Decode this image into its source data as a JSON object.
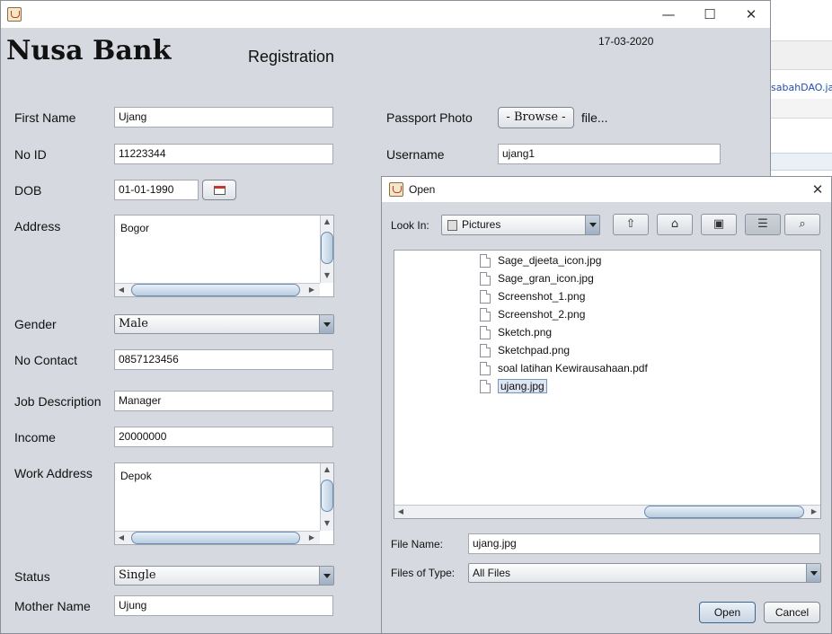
{
  "background": {
    "ide_tab_text": "sabahDAO.java"
  },
  "window": {
    "date": "17-03-2020",
    "bank_title": "Nusa Bank",
    "form_title": "Registration",
    "controls": {
      "minimize": "—",
      "maximize": "☐",
      "close": "✕"
    }
  },
  "form": {
    "first_name": {
      "label": "First Name",
      "value": "Ujang"
    },
    "no_id": {
      "label": "No ID",
      "value": "11223344"
    },
    "dob": {
      "label": "DOB",
      "value": "01-01-1990"
    },
    "address": {
      "label": "Address",
      "value": "Bogor"
    },
    "gender": {
      "label": "Gender",
      "value": "Male"
    },
    "no_contact": {
      "label": "No Contact",
      "value": "0857123456"
    },
    "job_description": {
      "label": "Job Description",
      "value": "Manager"
    },
    "income": {
      "label": "Income",
      "value": "20000000"
    },
    "work_address": {
      "label": "Work Address",
      "value": "Depok"
    },
    "status": {
      "label": "Status",
      "value": "Single"
    },
    "mother_name": {
      "label": "Mother Name",
      "value": "Ujung"
    },
    "passport_photo": {
      "label": "Passport Photo",
      "browse_label": "- Browse -",
      "file_text": "file..."
    },
    "username": {
      "label": "Username",
      "value": "ujang1"
    }
  },
  "dialog": {
    "title": "Open",
    "close": "✕",
    "look_in_label": "Look In:",
    "look_in_value": "Pictures",
    "files": [
      {
        "name": "Sage_djeeta_icon.jpg",
        "selected": false
      },
      {
        "name": "Sage_gran_icon.jpg",
        "selected": false
      },
      {
        "name": "Screenshot_1.png",
        "selected": false
      },
      {
        "name": "Screenshot_2.png",
        "selected": false
      },
      {
        "name": "Sketch.png",
        "selected": false
      },
      {
        "name": "Sketchpad.png",
        "selected": false
      },
      {
        "name": "soal latihan Kewirausahaan.pdf",
        "selected": false
      },
      {
        "name": "ujang.jpg",
        "selected": true
      }
    ],
    "file_name_label": "File Name:",
    "file_name_value": "ujang.jpg",
    "files_of_type_label": "Files of Type:",
    "files_of_type_value": "All Files",
    "open_label": "Open",
    "cancel_label": "Cancel"
  }
}
